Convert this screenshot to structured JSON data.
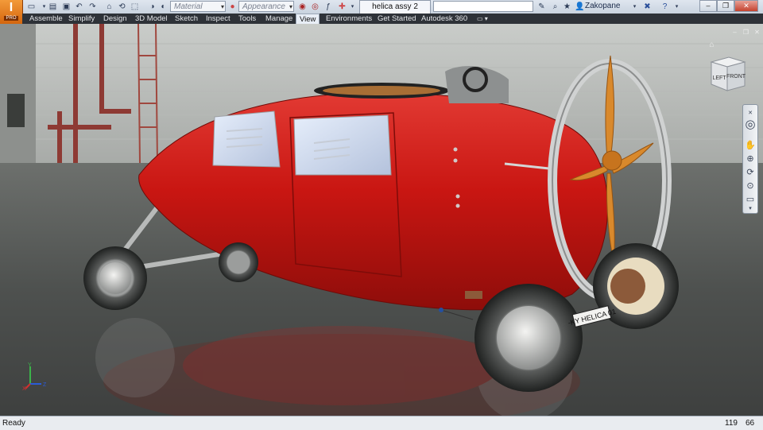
{
  "app_button": {
    "logo": "I",
    "edition": "PRO"
  },
  "quick_access": {
    "material_placeholder": "Material",
    "appearance_placeholder": "Appearance"
  },
  "document_tab": {
    "label": "helica assy 2"
  },
  "user": {
    "name": "Zakopane"
  },
  "ribbon": {
    "tabs": [
      "Assemble",
      "Simplify",
      "Design",
      "3D Model",
      "Sketch",
      "Inspect",
      "Tools",
      "Manage",
      "View",
      "Environments",
      "Get Started",
      "Autodesk 360"
    ],
    "active_tab": "View"
  },
  "viewcube": {
    "face_left": "LEFT",
    "face_front": "FRONT"
  },
  "model": {
    "license_plate": "-KY HELICA 01"
  },
  "triad": {
    "x": "X",
    "y": "Y",
    "z": "Z"
  },
  "status": {
    "text": "Ready",
    "count_a": "119",
    "count_b": "66"
  },
  "colors": {
    "car_body": "#c91612",
    "propeller": "#d9892c",
    "ribbon_bg": "#2e3238",
    "app_button": "#e07a20"
  }
}
